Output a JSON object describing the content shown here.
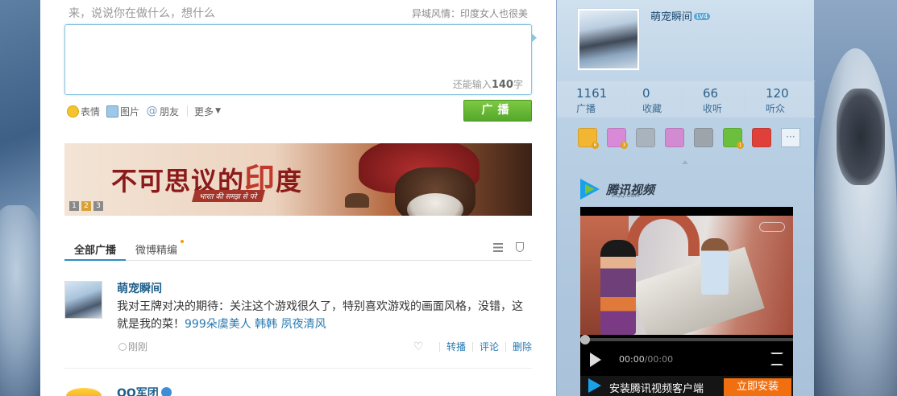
{
  "compose": {
    "prompt": "来，说说你在做什么，想什么",
    "topic": "异域风情：印度女人也很美",
    "counter_prefix": "还能输入",
    "counter_value": "140",
    "counter_suffix": "字"
  },
  "tools": {
    "emoji": "表情",
    "image": "图片",
    "friend": "朋友",
    "more": "更多"
  },
  "broadcast_button": "广播",
  "banner": {
    "title_a": "不可思议的",
    "title_b": "印",
    "title_c": "度",
    "subtitle": "भारत की समझ से परे",
    "pages": [
      "1",
      "2",
      "3"
    ],
    "active_page": 2
  },
  "feed_tabs": {
    "all": "全部广播",
    "featured": "微博精编"
  },
  "post": {
    "author": "萌宠瞬间",
    "text": "我对王牌对决的期待：关注这个游戏很久了，特别喜欢游戏的画面风格，没错，这就是我的菜！",
    "mentions": "999朵虞美人 韩韩 夙夜清风",
    "time": "刚刚",
    "actions": {
      "repost": "转播",
      "comment": "评论",
      "delete": "删除"
    }
  },
  "post2": {
    "author": "QQ军团"
  },
  "profile": {
    "name": "萌宠瞬间",
    "level": "LV4",
    "stats": [
      {
        "num": "1161",
        "label": "广播"
      },
      {
        "num": "0",
        "label": "收藏"
      },
      {
        "num": "66",
        "label": "收听"
      },
      {
        "num": "120",
        "label": "听众"
      }
    ],
    "apps": [
      {
        "name": "app-game-icon",
        "color": "#f2b632",
        "badge": "6"
      },
      {
        "name": "app-mail-icon",
        "color": "#d98ad6",
        "badge": "3"
      },
      {
        "name": "app-search-icon",
        "color": "#a9b3bd",
        "badge": ""
      },
      {
        "name": "app-gift-icon",
        "color": "#d28bd0",
        "badge": ""
      },
      {
        "name": "app-music-icon",
        "color": "#9da4ab",
        "badge": ""
      },
      {
        "name": "app-chat-icon",
        "color": "#6cbf3c",
        "badge": "1"
      },
      {
        "name": "app-star-icon",
        "color": "#e0403a",
        "badge": ""
      }
    ],
    "more": "···"
  },
  "video": {
    "brand": "腾讯视频",
    "url": "V.QQ.COM",
    "time_current": "00:00",
    "time_total": "/00:00",
    "progress": 0,
    "install_text": "安装腾讯视频客户端",
    "install_button": "立即安装"
  }
}
